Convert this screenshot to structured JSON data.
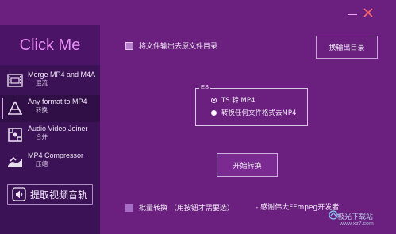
{
  "window": {
    "minimize_icon": "minimize-icon",
    "close_icon": "close-icon",
    "close_color": "#ff6a6a"
  },
  "sidebar": {
    "app_title": "Click Me",
    "title_color": "#e98cf5",
    "items": [
      {
        "title": "Merge MP4 and M4A",
        "subtitle": "混流",
        "icon": "merge-film-icon",
        "active": false
      },
      {
        "title": "Any format to MP4",
        "subtitle": "转换",
        "icon": "convert-icon",
        "active": true
      },
      {
        "title": "Audio Video Joiner",
        "subtitle": "合并",
        "icon": "joiner-icon",
        "active": false
      },
      {
        "title": "MP4 Compressor",
        "subtitle": "压缩",
        "icon": "compressor-icon",
        "active": false
      }
    ],
    "extract_button": {
      "label": "提取视频音轨",
      "icon": "speaker-icon"
    }
  },
  "main": {
    "output_to_source_checkbox": {
      "label": "将文件输出去原文件目录"
    },
    "change_output_button": "换输出目录",
    "es_group": {
      "legend": "ES",
      "options": [
        {
          "label": "TS 转 MP4",
          "selected": true
        },
        {
          "label": "转换任何文件格式去MP4",
          "selected": false
        }
      ]
    },
    "start_button": "开始转换",
    "batch_checkbox": {
      "label": "批量转换  （用按钮才需要选）"
    },
    "credit": "- 感谢伟大FFmpeg开发者"
  },
  "watermark": {
    "text": "极光下载站",
    "url": "www.xz7.com"
  }
}
